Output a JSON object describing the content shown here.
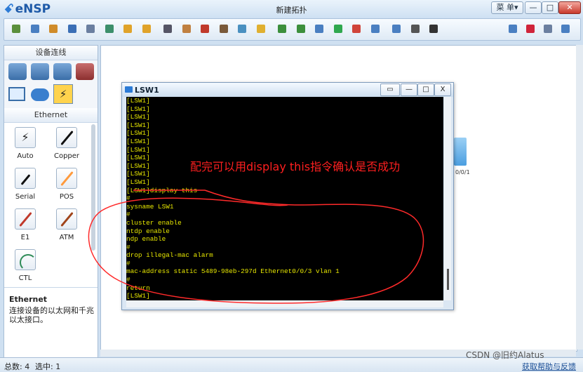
{
  "app": {
    "logo": "eNSP",
    "window_title": "新建拓扑"
  },
  "window_buttons": {
    "menu": "菜 单",
    "minimize": "—",
    "maximize": "□",
    "close": "✕"
  },
  "toolbar_icons": [
    "new-topology-icon",
    "new-exam-icon",
    "open-icon",
    "save-icon",
    "save-as-icon",
    "print-icon",
    "undo-icon",
    "redo-icon",
    "select-icon",
    "pan-icon",
    "delete-icon",
    "delete-links-icon",
    "text-icon",
    "palette-icon",
    "zoom-in-icon",
    "zoom-out-icon",
    "fit-icon",
    "start-icon",
    "stop-icon",
    "capture-icon",
    "topology-icon",
    "fullscreen-icon",
    "cli-icon",
    "feedback-icon",
    "huawei-icon",
    "settings-icon",
    "help-icon"
  ],
  "left_panel": {
    "title": "设备连线",
    "subcategory": "Ethernet",
    "cables": [
      "Auto",
      "Copper",
      "Serial",
      "POS",
      "E1",
      "ATM",
      "CTL"
    ],
    "description_title": "Ethernet",
    "description_text": "连接设备的以太网和千兆以太接口。"
  },
  "canvas": {
    "port_label": "0/0/1"
  },
  "terminal": {
    "title": "LSW1",
    "mode_btn": "▭",
    "min_btn": "—",
    "max_btn": "□",
    "close_btn": "X",
    "lines": [
      "[LSW1]",
      "[LSW1]",
      "[LSW1]",
      "[LSW1]",
      "[LSW1]",
      "[LSW1]",
      "[LSW1]",
      "[LSW1]",
      "[LSW1]",
      "[LSW1]",
      "[LSW1]",
      "[LSW1]display this",
      "#",
      "sysname LSW1",
      "#",
      "cluster enable",
      "ntdp enable",
      "ndp enable",
      "#",
      "drop illegal-mac alarm",
      "#",
      "mac-address static 5489-98eb-297d Ethernet0/0/3 vlan 1",
      "#",
      "return",
      "[LSW1]"
    ]
  },
  "annotation": {
    "text": "配完可以用display this指令确认是否成功",
    "color": "#ff1f1f"
  },
  "status": {
    "total": "总数: 4",
    "selected": "选中: 1",
    "help": "获取帮助与反馈"
  },
  "watermark": "CSDN @旧约Alatus"
}
